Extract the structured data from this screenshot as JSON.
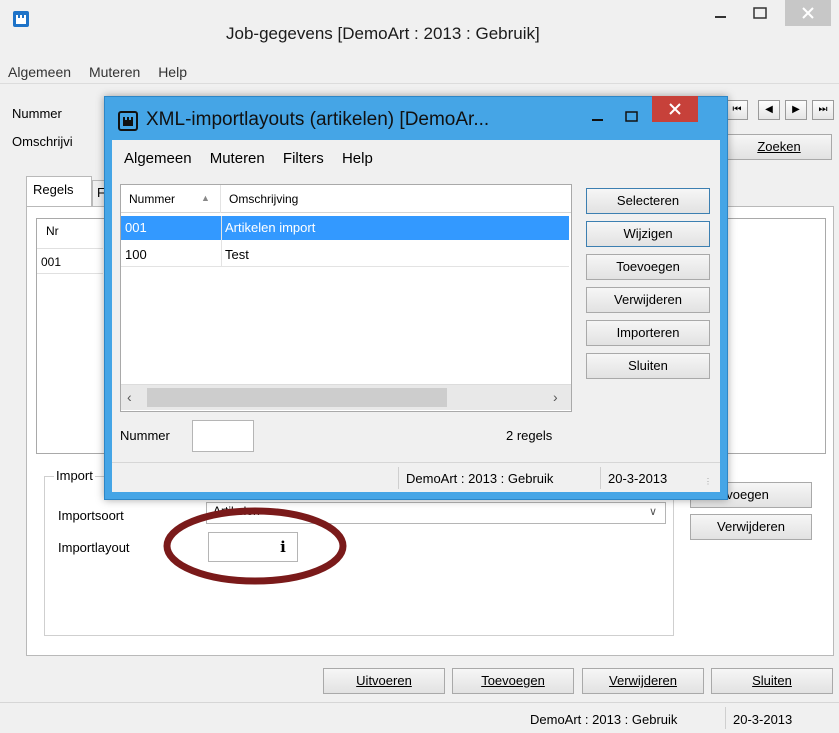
{
  "main": {
    "title": "Job-gegevens  [DemoArt : 2013 : Gebruik]",
    "menu": [
      "Algemeen",
      "Muteren",
      "Help"
    ],
    "nummer_label": "Nummer",
    "omschrijving_label": "Omschrijvi",
    "tabs": [
      "Regels",
      "F"
    ],
    "table_header_nr": "Nr",
    "table_row_nr": "001",
    "nav_buttons": [
      "⏮",
      "◀",
      "▶",
      "⏭"
    ],
    "zoeken_label": "Zoeken",
    "import_group_label": "Import",
    "importsoort_label": "Importsoort",
    "importsoort_value": "Artikelen",
    "importlayout_label": "Importlayout",
    "info_label": "i",
    "toevoegen_side_label": "Toevoegen",
    "toevoegen_side_visible": "evoegen",
    "verwijderen_side_label": "Verwijderen",
    "bottom_buttons": {
      "uitvoeren": "Uitvoeren",
      "toevoegen": "Toevoegen",
      "verwijderen": "Verwijderen",
      "sluiten": "Sluiten"
    },
    "status_company": "DemoArt : 2013 : Gebruik",
    "status_date": "20-3-2013"
  },
  "dialog": {
    "title": "XML-importlayouts (artikelen)  [DemoAr...",
    "menu": [
      "Algemeen",
      "Muteren",
      "Filters",
      "Help"
    ],
    "columns": [
      "Nummer",
      "Omschrijving"
    ],
    "rows": [
      {
        "nummer": "001",
        "omschrijving": "Artikelen import",
        "selected": true
      },
      {
        "nummer": "100",
        "omschrijving": "Test",
        "selected": false
      }
    ],
    "buttons": {
      "selecteren": "Selecteren",
      "wijzigen": "Wijzigen",
      "toevoegen": "Toevoegen",
      "verwijderen": "Verwijderen",
      "importeren": "Importeren",
      "sluiten": "Sluiten"
    },
    "nummer_label": "Nummer",
    "count_text": "2 regels",
    "status_company": "DemoArt : 2013 : Gebruik",
    "status_date": "20-3-2013"
  },
  "colors": {
    "dialog_frame": "#45a5e6",
    "close_red": "#c7413a",
    "selection": "#3399ff",
    "annotation": "#7a1a1a"
  }
}
